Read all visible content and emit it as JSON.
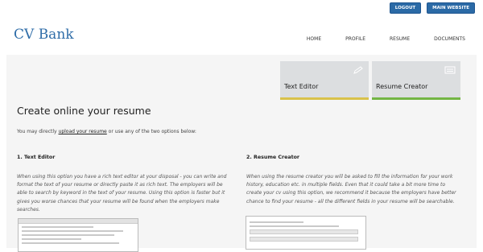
{
  "topbar": {
    "logout": "LOGOUT",
    "main_website": "MAIN WEBSITE"
  },
  "brand": {
    "logo": "CV Bank"
  },
  "nav": {
    "items": [
      "HOME",
      "PROFILE",
      "RESUME",
      "DOCUMENTS"
    ]
  },
  "tiles": {
    "text_editor": {
      "label": "Text Editor",
      "accent": "#d9c24a",
      "icon": "pencil-icon"
    },
    "resume_creator": {
      "label": "Resume Creator",
      "accent": "#73b544",
      "icon": "form-icon"
    }
  },
  "main": {
    "title": "Create online your resume",
    "intro_pre": "You may directly ",
    "intro_link": "upload your resume",
    "intro_post": " or use any of the two options below:"
  },
  "options": [
    {
      "heading": "1. Text Editor",
      "text": "When using this option you have a rich text editor at your disposal - you can write and format the text of your resume or directly paste it as rich text. The employers will be able to search by keyword in the text of your resume. Using this option is faster but it gives you worse chances that your resume will be found when the employers make searches."
    },
    {
      "heading": "2. Resume Creator",
      "text": "When using the resume creator you will be asked to fill the information for your work history, education etc. in multiple fields. Even that it could take a bit more time to create your cv using this option, we recommend it because the employers have better chance to find your resume - all the different fields in your resume will be searchable."
    }
  ]
}
